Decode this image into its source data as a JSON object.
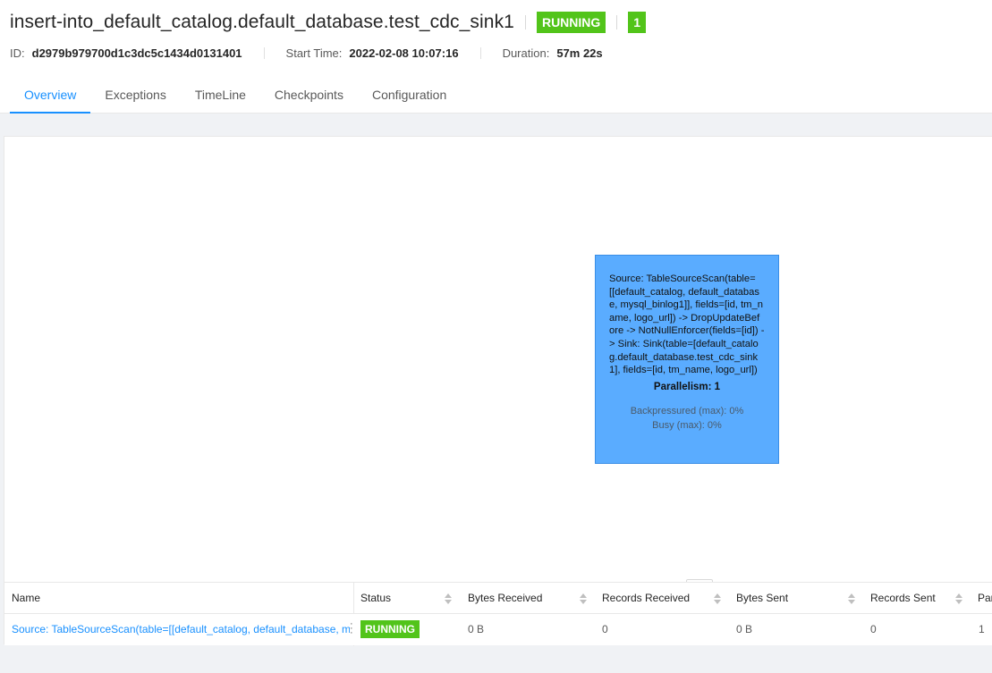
{
  "job": {
    "title": "insert-into_default_catalog.default_database.test_cdc_sink1",
    "status": "RUNNING",
    "count": "1",
    "id_label": "ID:",
    "id_value": "d2979b979700d1c3dc5c1434d0131401",
    "start_label": "Start Time:",
    "start_value": "2022-02-08 10:07:16",
    "duration_label": "Duration:",
    "duration_value": "57m 22s"
  },
  "tabs": [
    {
      "label": "Overview",
      "active": true
    },
    {
      "label": "Exceptions"
    },
    {
      "label": "TimeLine"
    },
    {
      "label": "Checkpoints"
    },
    {
      "label": "Configuration"
    }
  ],
  "node": {
    "description": "Source: TableSourceScan(table=[[default_catalog, default_database, mysql_binlog1]], fields=[id, tm_name, logo_url]) -> DropUpdateBefore -> NotNullEnforcer(fields=[id]) -> Sink: Sink(table=[default_catalog.default_database.test_cdc_sink1], fields=[id, tm_name, logo_url])",
    "parallelism": "Parallelism: 1",
    "backpressured": "Backpressured (max): 0%",
    "busy": "Busy (max): 0%"
  },
  "resize_handle": "...",
  "table": {
    "headers": [
      "Name",
      "Status",
      "Bytes Received",
      "Records Received",
      "Bytes Sent",
      "Records Sent",
      "Par"
    ],
    "rows": [
      {
        "name": "Source: TableSourceScan(table=[[default_catalog, default_database, m...",
        "status": "RUNNING",
        "bytes_received": "0 B",
        "records_received": "0",
        "bytes_sent": "0 B",
        "records_sent": "0",
        "parallelism": "1"
      }
    ]
  },
  "colors": {
    "accent": "#1890ff",
    "running": "#52c41a",
    "node_fill": "#5aacff"
  }
}
